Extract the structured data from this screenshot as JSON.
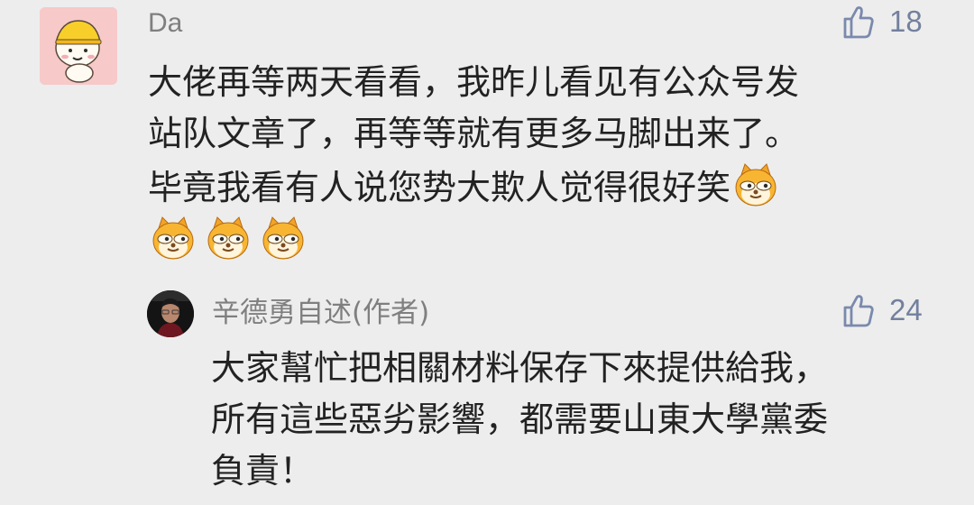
{
  "comment": {
    "author": "Da",
    "like_count": "18",
    "text_lines": [
      "大佬再等两天看看，我昨儿看见有公众号发",
      "站队文章了，再等等就有更多马脚出来了。",
      "毕竟我看有人说您势大欺人觉得很好笑"
    ],
    "emoji_name": "doge-emoji",
    "emoji_count": 4
  },
  "reply": {
    "author": "辛德勇自述(作者)",
    "like_count": "24",
    "text_lines": [
      "大家幫忙把相關材料保存下來提供給我，",
      "所有這些惡劣影響，都需要山東大學黨委",
      "負責！"
    ]
  },
  "colors": {
    "background": "#ededed",
    "text": "#222222",
    "meta_text": "#7f7f7f",
    "like_accent": "#7a89ad"
  }
}
